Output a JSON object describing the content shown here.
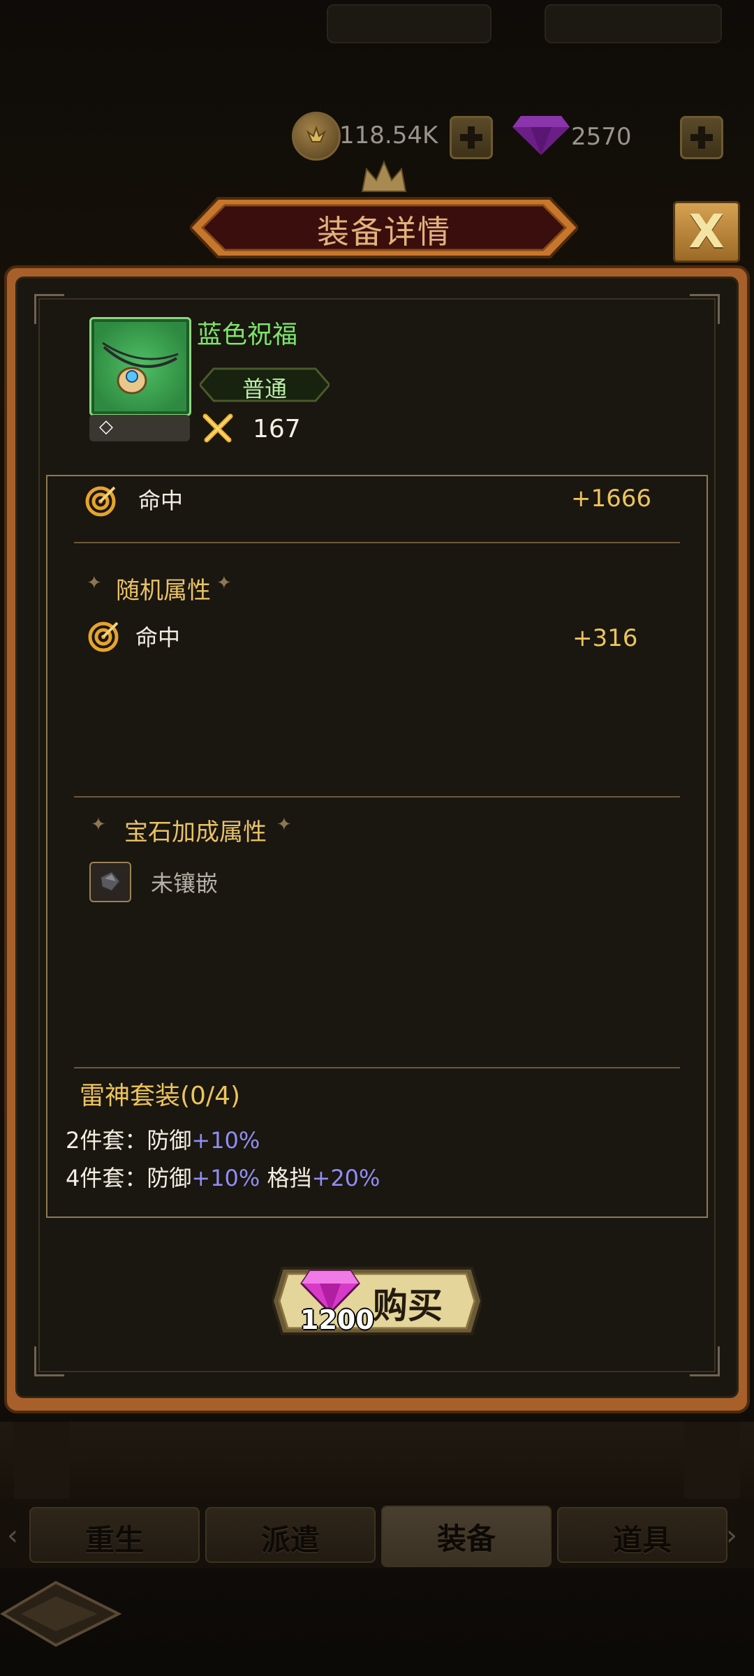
{
  "currency": {
    "gold": "118.54K",
    "gems": "2570"
  },
  "header": {
    "title": "装备详情",
    "close_label": "X"
  },
  "item": {
    "name": "蓝色祝福",
    "rarity": "普通",
    "slot_symbol": "◇",
    "power": "167",
    "icon": "amulet-necklace-icon"
  },
  "base_stats": [
    {
      "label": "命中",
      "value": "+1666",
      "icon": "target-icon"
    }
  ],
  "random_attributes": {
    "title": "随机属性",
    "stats": [
      {
        "label": "命中",
        "value": "+316",
        "icon": "target-icon"
      }
    ]
  },
  "gem_bonus": {
    "title": "宝石加成属性",
    "slot_label": "未镶嵌"
  },
  "set_bonus": {
    "title": "雷神套装(0/4)",
    "lines": [
      {
        "prefix": "2件套：防御",
        "bonus1": "+10%",
        "mid": "",
        "bonus2": ""
      },
      {
        "prefix": "4件套：防御",
        "bonus1": "+10%",
        "mid": " 格挡",
        "bonus2": "+20%"
      }
    ]
  },
  "buy": {
    "label": "购买",
    "price": "1200"
  },
  "tabs": [
    {
      "label": "重生",
      "active": false
    },
    {
      "label": "派遣",
      "active": false
    },
    {
      "label": "装备",
      "active": true
    },
    {
      "label": "道具",
      "active": false
    }
  ],
  "colors": {
    "panel_frame": "#a7602a",
    "item_name": "#7ce56a",
    "stat_value": "#ecc45a",
    "set_bonus_value": "#8f8ef2",
    "section_title": "#e8c265"
  }
}
